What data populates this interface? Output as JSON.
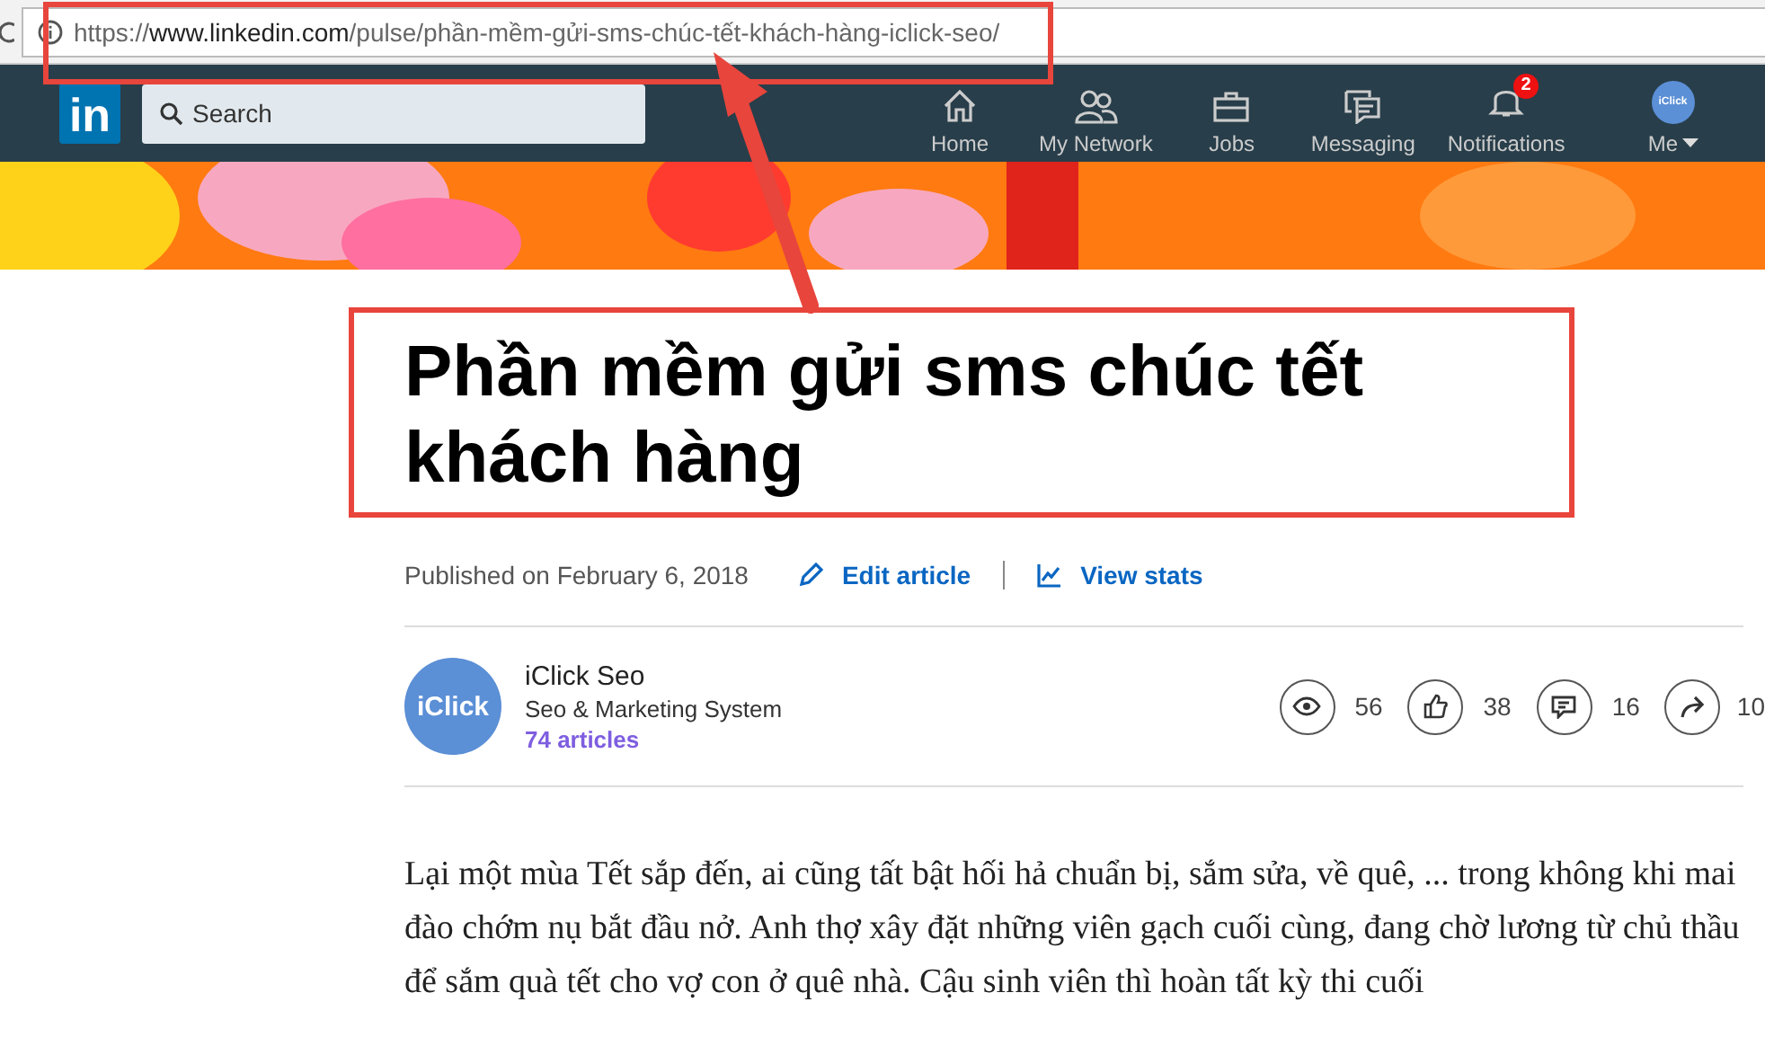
{
  "address_bar": {
    "url_prefix": "https://",
    "url_domain": "www.linkedin.com",
    "url_path": "/pulse/phần-mềm-gửi-sms-chúc-tết-khách-hàng-iclick-seo/"
  },
  "navbar": {
    "logo": "in",
    "search": {
      "placeholder": "Search"
    },
    "items": [
      {
        "label": "Home"
      },
      {
        "label": "My Network"
      },
      {
        "label": "Jobs"
      },
      {
        "label": "Messaging"
      },
      {
        "label": "Notifications",
        "badge": "2"
      },
      {
        "label": "Me",
        "avatar_text": "iClick"
      }
    ]
  },
  "article": {
    "title": "Phần mềm gửi sms chúc tết khách hàng",
    "published": "Published on February 6, 2018",
    "actions": [
      {
        "label": "Edit article"
      },
      {
        "label": "View stats"
      }
    ],
    "author": {
      "avatar_text": "iClick",
      "name": "iClick Seo",
      "headline": "Seo & Marketing System",
      "articles": "74 articles"
    },
    "stats": [
      {
        "count": "56"
      },
      {
        "count": "38"
      },
      {
        "count": "16"
      },
      {
        "count": "10"
      }
    ],
    "body": "Lại một mùa Tết sắp đến, ai cũng tất bật hối hả chuẩn bị, sắm sửa, về quê, ... trong không khi mai đào chớm nụ bắt đầu nở. Anh thợ xây đặt những viên gạch cuối cùng, đang chờ lương từ chủ thầu để sắm quà tết cho vợ con ở quê nhà. Cậu sinh viên thì hoàn tất kỳ thi cuối"
  }
}
